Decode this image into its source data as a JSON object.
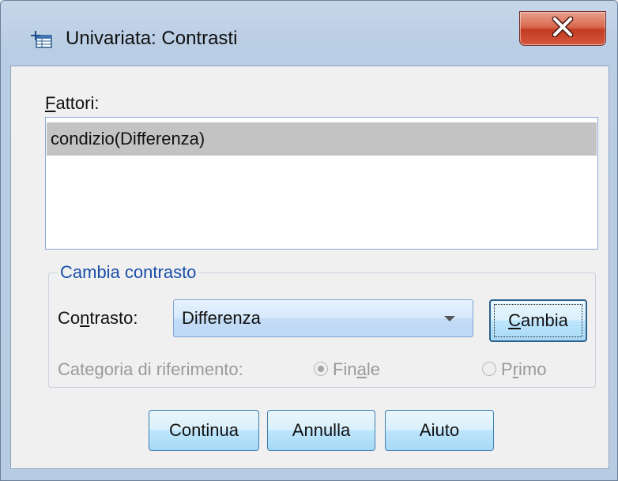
{
  "window": {
    "title": "Univariata: Contrasti",
    "close_icon": "close-x-icon"
  },
  "factors": {
    "label_prefix": "F",
    "label_rest": "attori:",
    "items": [
      "condizio(Differenza)"
    ],
    "selected_index": 0
  },
  "change_contrast": {
    "group_label": "Cambia contrasto",
    "contrast_label_a": "Co",
    "contrast_label_u": "n",
    "contrast_label_b": "trasto:",
    "contrast_value": "Differenza",
    "change_button_u": "C",
    "change_button_rest": "ambia",
    "reference_label": "Categoria di riferimento:",
    "radio_last_a": "Fin",
    "radio_last_u": "a",
    "radio_last_b": "le",
    "radio_first_a": "P",
    "radio_first_u": "r",
    "radio_first_b": "imo",
    "selected_reference": "Finale"
  },
  "buttons": {
    "continue": "Continua",
    "cancel": "Annulla",
    "help": "Aiuto"
  }
}
